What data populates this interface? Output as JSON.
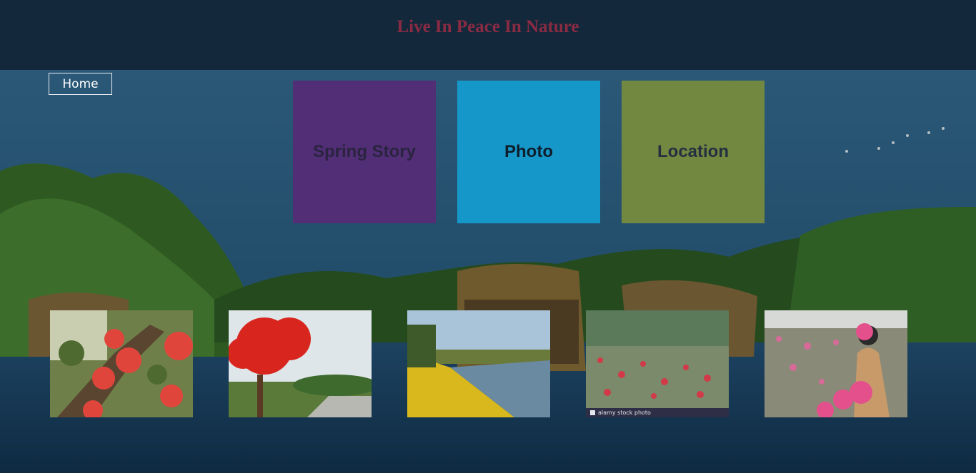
{
  "header": {
    "title": "Live In Peace In Nature"
  },
  "nav": {
    "home_label": "Home"
  },
  "tiles": [
    {
      "label": "Spring Story",
      "color": "#522e76"
    },
    {
      "label": "Photo",
      "color": "#1598c9"
    },
    {
      "label": "Location",
      "color": "#728840"
    }
  ],
  "gallery": {
    "images": [
      {
        "name": "red-blossom-branch-photo"
      },
      {
        "name": "flame-tree-roadside-photo"
      },
      {
        "name": "yellow-flower-riverbank-photo"
      },
      {
        "name": "red-flower-field-photo",
        "caption": "alamy stock photo"
      },
      {
        "name": "pink-lotus-girl-photo"
      }
    ]
  },
  "colors": {
    "header_bg": "#13283a",
    "title": "#8a2b43"
  }
}
